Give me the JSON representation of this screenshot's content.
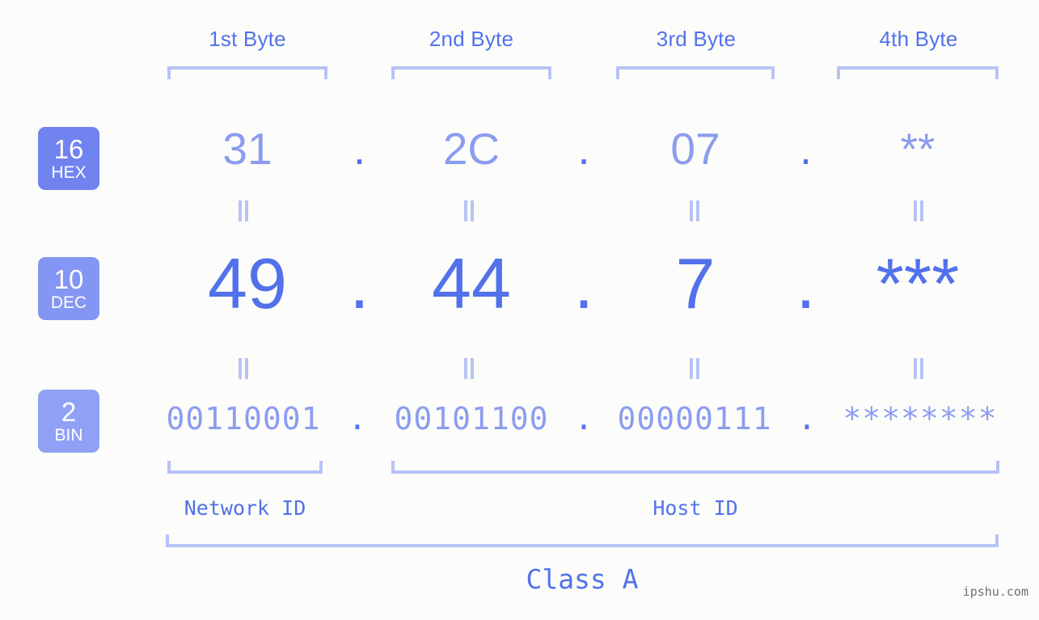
{
  "background_color": "#fcfdfa",
  "accent_color": "#5271eb",
  "muted_accent_color": "#8c9cf0",
  "bracket_color": "#b8c2f7",
  "headers": {
    "byte1": "1st Byte",
    "byte2": "2nd Byte",
    "byte3": "3rd Byte",
    "byte4": "4th Byte"
  },
  "rows": {
    "hex": {
      "badge_number": "16",
      "badge_base": "HEX",
      "badge_color": "#7083ef",
      "values": [
        "31",
        "2C",
        "07",
        "**"
      ],
      "separator": "."
    },
    "dec": {
      "badge_number": "10",
      "badge_base": "DEC",
      "badge_color": "#8496f3",
      "values": [
        "49",
        "44",
        "7",
        "***"
      ],
      "separator": "."
    },
    "bin": {
      "badge_number": "2",
      "badge_base": "BIN",
      "badge_color": "#90a1f5",
      "values": [
        "00110001",
        "00101100",
        "00000111",
        "********"
      ],
      "separator": "."
    }
  },
  "equals_marks": {
    "glyph": "||",
    "count_per_row": 4
  },
  "segments": {
    "network_id": "Network ID",
    "host_id": "Host ID",
    "class": "Class A"
  },
  "watermark": "ipshu.com"
}
